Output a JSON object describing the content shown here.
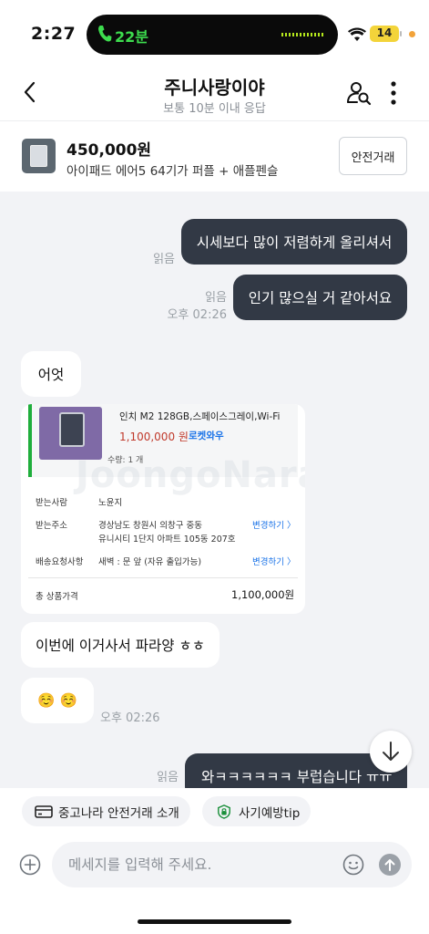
{
  "status_bar": {
    "time": "2:27",
    "call_duration": "22분",
    "battery": "14"
  },
  "header": {
    "title": "주니사랑이야",
    "subtitle": "보통 10분 이내 응답"
  },
  "product": {
    "price": "450,000원",
    "name": "아이패드 에어5 64기가 퍼플 + 애플펜슬",
    "safe_trade_label": "안전거래"
  },
  "messages": {
    "m1": {
      "text": "시세보다 많이 저렴하게 올리셔서",
      "read": "읽음"
    },
    "m2": {
      "text": "인기 많으실 거 같아서요",
      "read": "읽음",
      "time": "오후 02:26"
    },
    "m3": {
      "text": "어엇"
    },
    "m5": {
      "text": "이번에 이거사서 파라양 ㅎㅎ"
    },
    "m6": {
      "text": "☺️ ☺️",
      "time": "오후 02:26"
    },
    "m7": {
      "text": "와ㅋㅋㅋㅋㅋㅋ 부럽습니다 ㅠㅠ",
      "read": "읽음"
    }
  },
  "order_image": {
    "spec": "인치 M2 128GB,스페이스그레이,Wi-Fi",
    "price": "1,100,000 원",
    "rocket": "로켓와우",
    "qty": "수량: 1 개",
    "receiver_label": "받는사람",
    "receiver_value": "노윤지",
    "address_label": "받는주소",
    "address_line1": "경상남도 창원시 의창구 중동",
    "address_line2": "유니시티 1단지 아파트 105동 207호",
    "change_label": "변경하기 〉",
    "delivery_label": "배송요청사항",
    "delivery_value": "새벽 : 문 앞 (자유 출입가능)",
    "total_label": "총 상품가격",
    "total_value": "1,100,000원",
    "watermark": "JoongoNara"
  },
  "quick_chips": {
    "intro": "중고나라 안전거래 소개",
    "tip": "사기예방tip"
  },
  "composer": {
    "placeholder": "메세지를 입력해 주세요."
  },
  "colors": {
    "my_bubble": "#323945",
    "chat_bg": "#f2f3f6",
    "rocket_blue": "#1a73e8",
    "price_red": "#c0392b"
  }
}
